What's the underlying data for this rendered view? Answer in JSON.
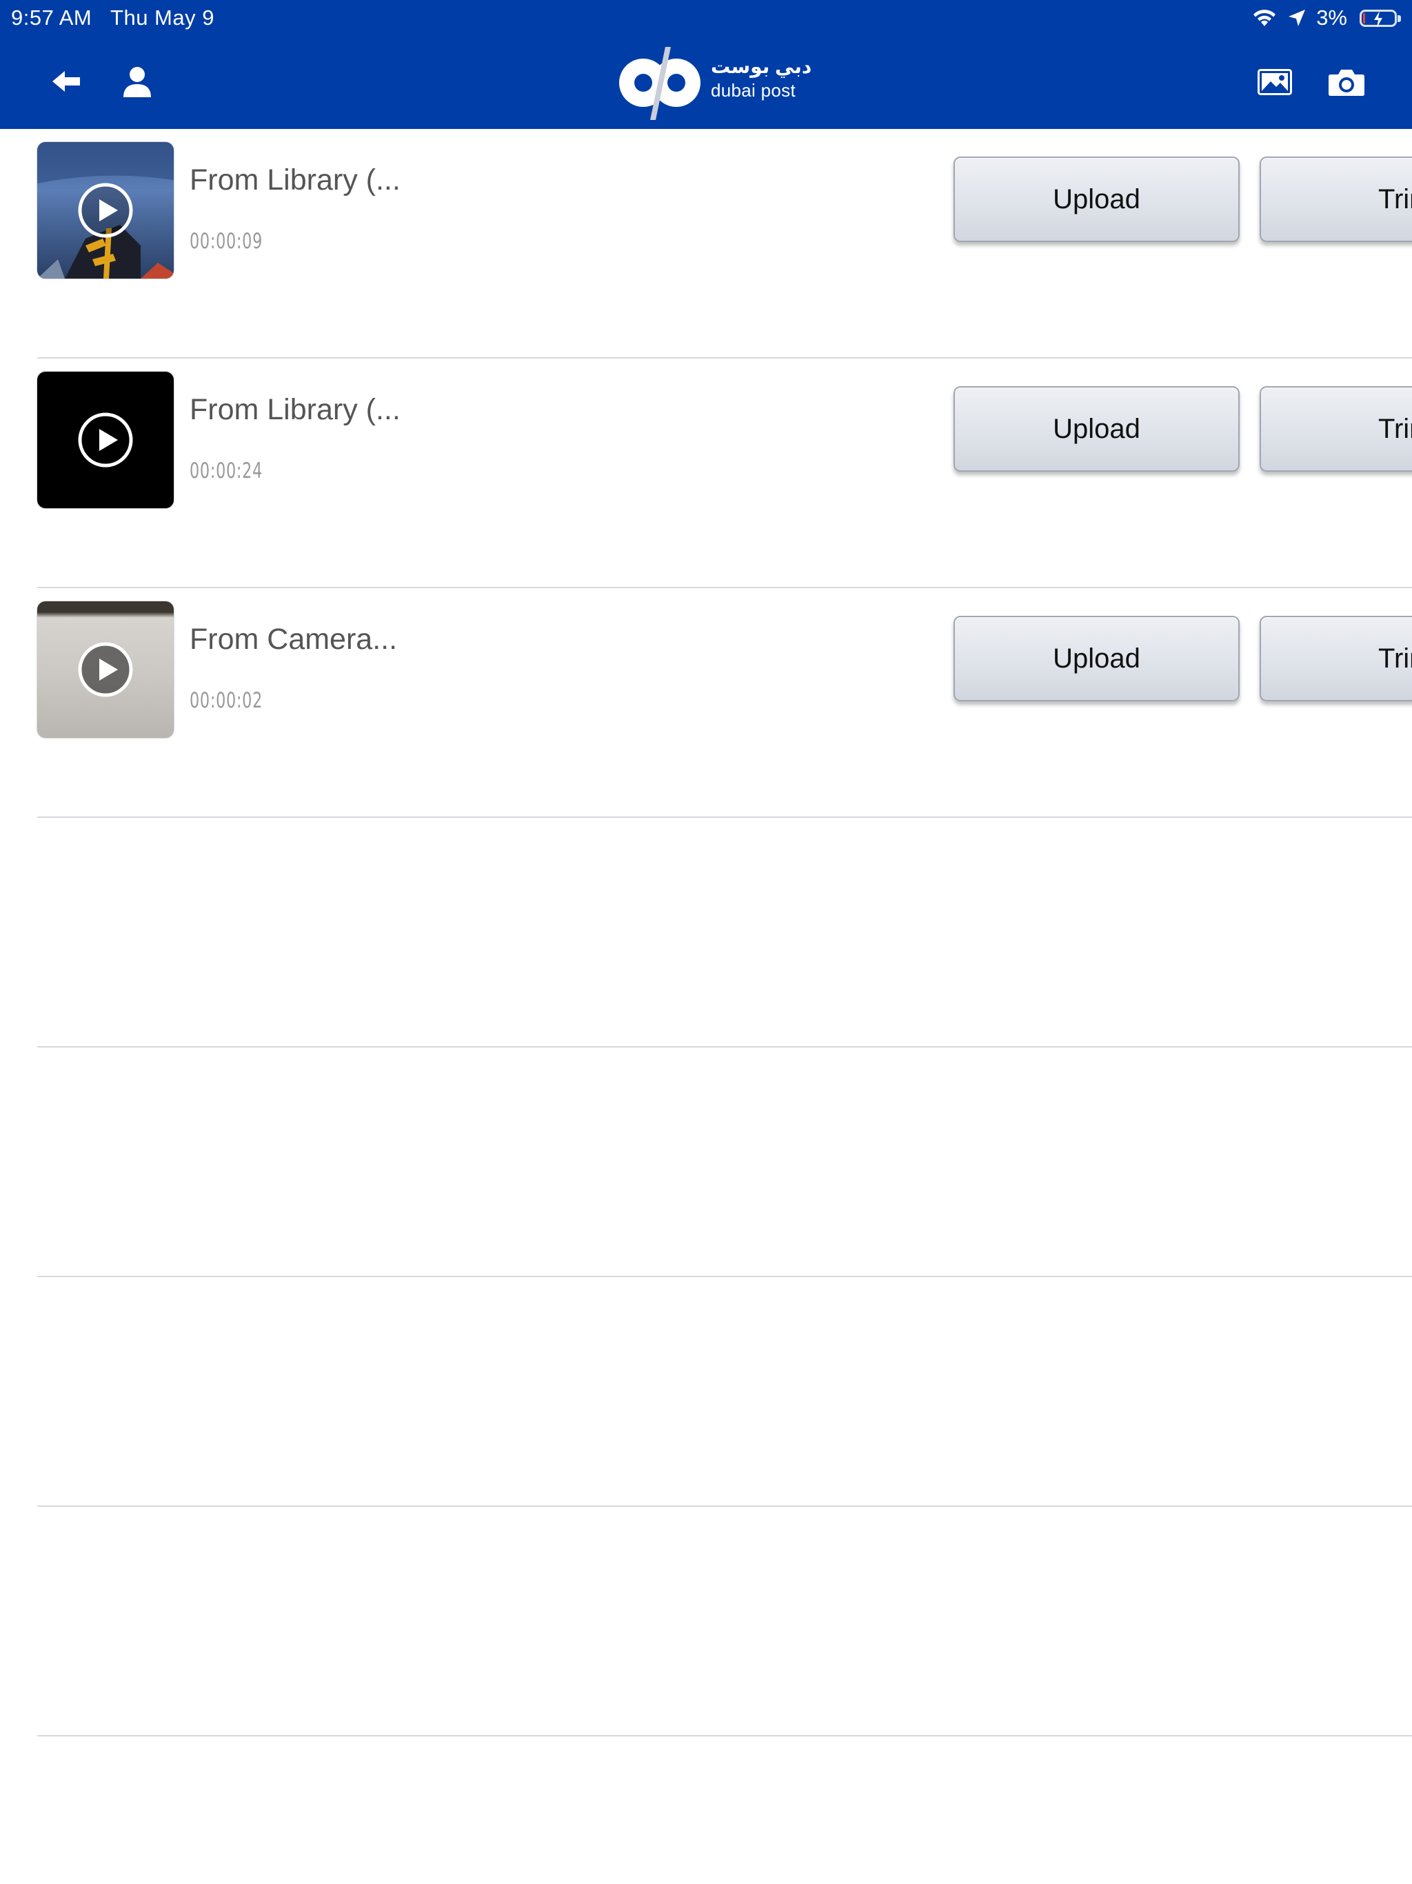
{
  "status_bar": {
    "time": "9:57 AM",
    "date": "Thu May 9",
    "battery_percent": "3%",
    "battery_level": 0.03
  },
  "header": {
    "logo_arabic": "دبي بوست",
    "logo_english": "dubai post",
    "background_color": "#003da6",
    "icons": [
      "back-arrow-icon",
      "user-icon",
      "photo-library-icon",
      "camera-icon"
    ]
  },
  "videos": [
    {
      "title": "From Library (...",
      "duration": "00:00:09",
      "upload_label": "Upload",
      "trim_label": "Trim"
    },
    {
      "title": "From Library (...",
      "duration": "00:00:24",
      "upload_label": "Upload",
      "trim_label": "Trim"
    },
    {
      "title": "From Camera...",
      "duration": "00:00:02",
      "upload_label": "Upload",
      "trim_label": "Trim"
    }
  ]
}
